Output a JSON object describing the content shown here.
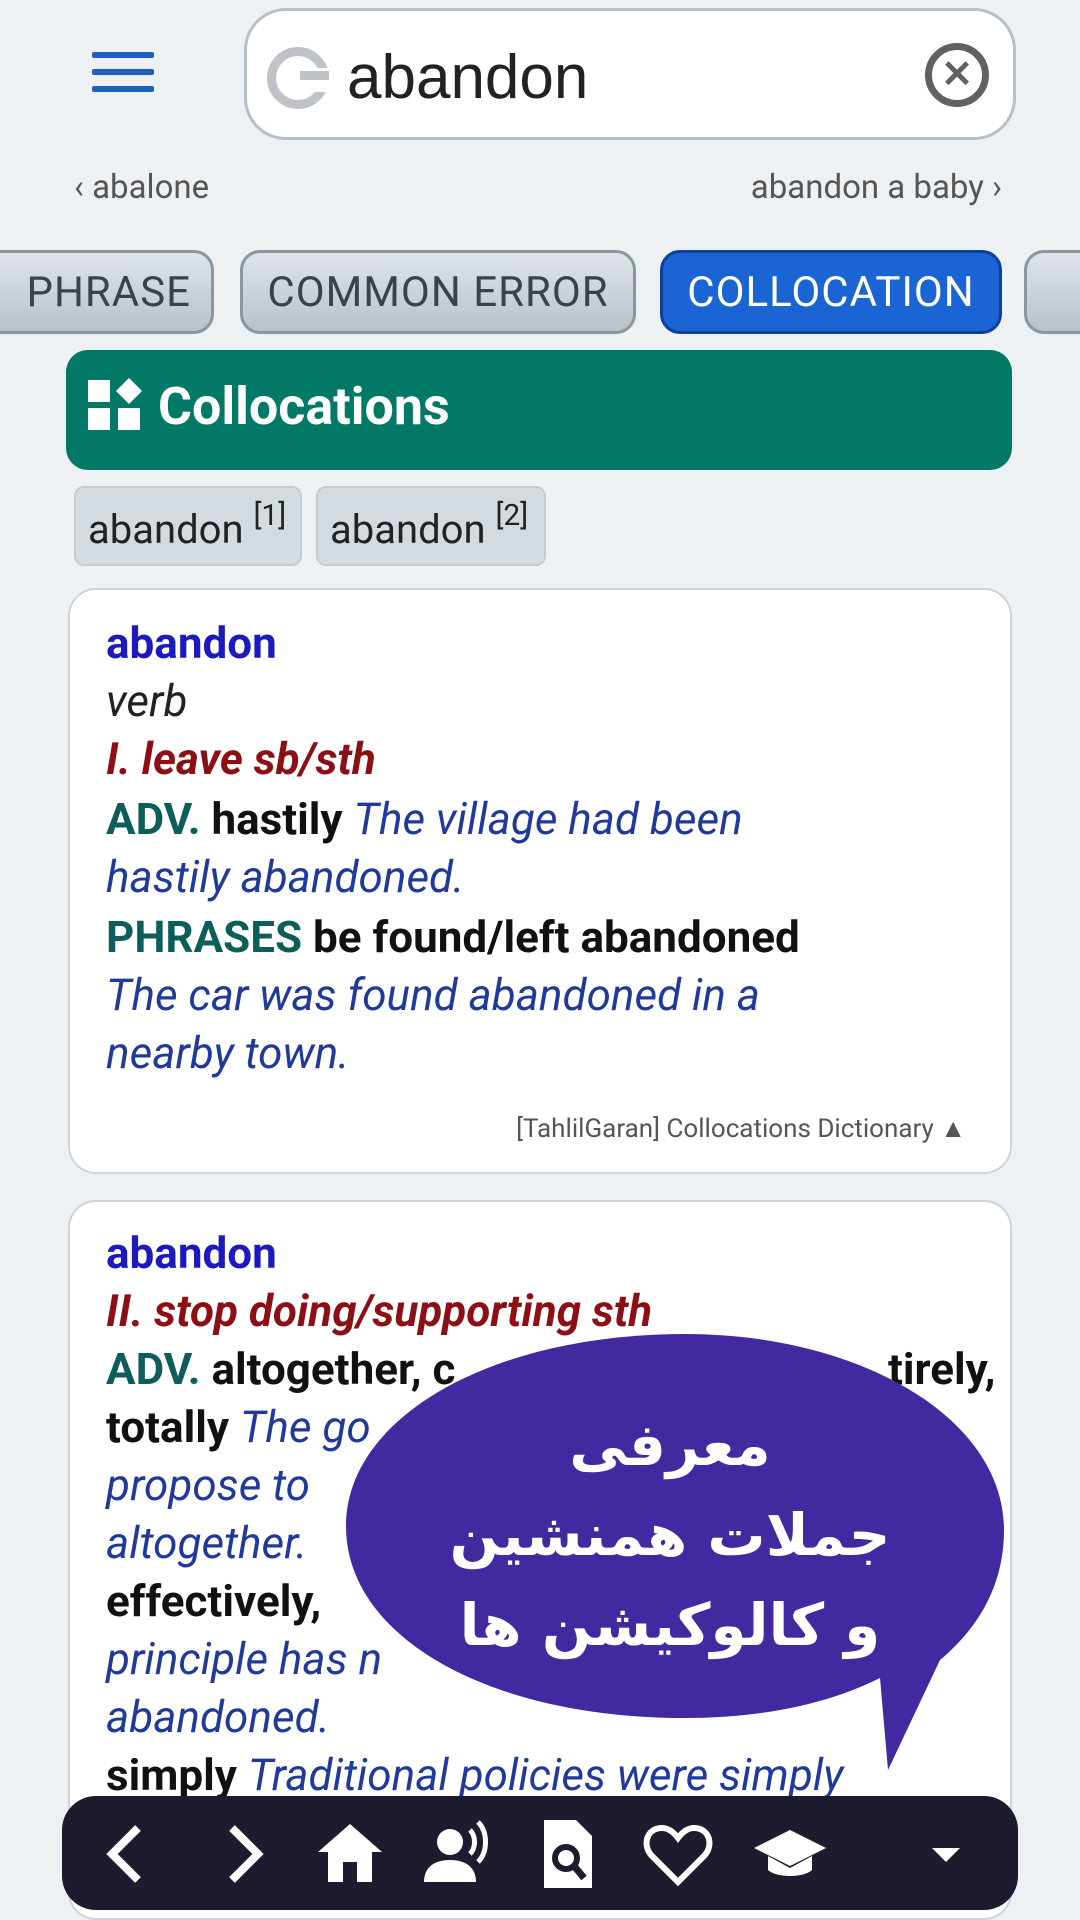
{
  "search": {
    "value": "abandon"
  },
  "nav_words": {
    "prev": "abalone",
    "next": "abandon a baby"
  },
  "tabs": [
    "PHRASE",
    "COMMON ERROR",
    "COLLOCATION",
    ""
  ],
  "section": {
    "title": "Collocations"
  },
  "chips": [
    {
      "label": "abandon",
      "sup": "[1]"
    },
    {
      "label": "abandon",
      "sup": "[2]"
    }
  ],
  "card1": {
    "headword": "abandon",
    "pos": "verb",
    "sense": "I. leave sb/sth",
    "adv_label": "ADV.",
    "adv_word": "hastily",
    "adv_example_1": "The village had been",
    "adv_example_2": "hastily abandoned.",
    "phr_label": "PHRASES",
    "phr_colloc": "be found/left abandoned",
    "phr_example_1": "The car was found abandoned in a",
    "phr_example_2": "nearby town.",
    "source": "[TahlilGaran] Collocations Dictionary ▲"
  },
  "card2": {
    "headword": "abandon",
    "sense": "II. stop doing/supporting sth",
    "adv_label": "ADV.",
    "line3_a": "altogether, c",
    "line3_b": "tirely,",
    "line4_a": "totally",
    "line4_b": "The go",
    "line5": "propose to",
    "line6": "altogether.",
    "line7": "effectively,",
    "line8": "principle has n",
    "line9": "abandoned.",
    "line10_a": "simply",
    "line10_b": "Traditional policies were simply"
  },
  "bubble": {
    "line1": "معرفی",
    "line2": "جملات همنشین",
    "line3": "و کالوکیشن ها",
    "color": "#4329a0"
  },
  "bottom_nav": [
    "back-icon",
    "forward-icon",
    "home-icon",
    "speaker-icon",
    "search-doc-icon",
    "heart-icon",
    "graduation-cap-icon",
    "dropdown-icon"
  ]
}
